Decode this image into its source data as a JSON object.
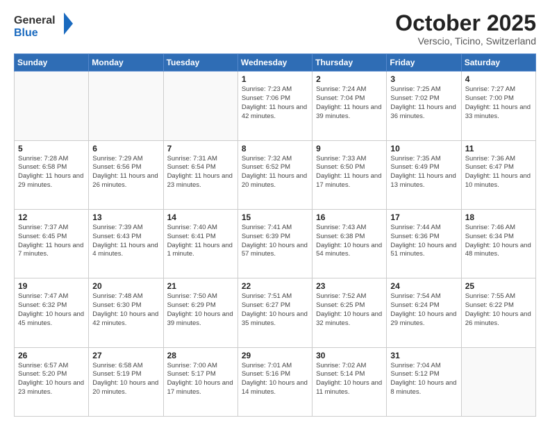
{
  "header": {
    "logo_general": "General",
    "logo_blue": "Blue",
    "month_title": "October 2025",
    "subtitle": "Verscio, Ticino, Switzerland"
  },
  "days_of_week": [
    "Sunday",
    "Monday",
    "Tuesday",
    "Wednesday",
    "Thursday",
    "Friday",
    "Saturday"
  ],
  "weeks": [
    [
      {
        "day": "",
        "info": ""
      },
      {
        "day": "",
        "info": ""
      },
      {
        "day": "",
        "info": ""
      },
      {
        "day": "1",
        "info": "Sunrise: 7:23 AM\nSunset: 7:06 PM\nDaylight: 11 hours and 42 minutes."
      },
      {
        "day": "2",
        "info": "Sunrise: 7:24 AM\nSunset: 7:04 PM\nDaylight: 11 hours and 39 minutes."
      },
      {
        "day": "3",
        "info": "Sunrise: 7:25 AM\nSunset: 7:02 PM\nDaylight: 11 hours and 36 minutes."
      },
      {
        "day": "4",
        "info": "Sunrise: 7:27 AM\nSunset: 7:00 PM\nDaylight: 11 hours and 33 minutes."
      }
    ],
    [
      {
        "day": "5",
        "info": "Sunrise: 7:28 AM\nSunset: 6:58 PM\nDaylight: 11 hours and 29 minutes."
      },
      {
        "day": "6",
        "info": "Sunrise: 7:29 AM\nSunset: 6:56 PM\nDaylight: 11 hours and 26 minutes."
      },
      {
        "day": "7",
        "info": "Sunrise: 7:31 AM\nSunset: 6:54 PM\nDaylight: 11 hours and 23 minutes."
      },
      {
        "day": "8",
        "info": "Sunrise: 7:32 AM\nSunset: 6:52 PM\nDaylight: 11 hours and 20 minutes."
      },
      {
        "day": "9",
        "info": "Sunrise: 7:33 AM\nSunset: 6:50 PM\nDaylight: 11 hours and 17 minutes."
      },
      {
        "day": "10",
        "info": "Sunrise: 7:35 AM\nSunset: 6:49 PM\nDaylight: 11 hours and 13 minutes."
      },
      {
        "day": "11",
        "info": "Sunrise: 7:36 AM\nSunset: 6:47 PM\nDaylight: 11 hours and 10 minutes."
      }
    ],
    [
      {
        "day": "12",
        "info": "Sunrise: 7:37 AM\nSunset: 6:45 PM\nDaylight: 11 hours and 7 minutes."
      },
      {
        "day": "13",
        "info": "Sunrise: 7:39 AM\nSunset: 6:43 PM\nDaylight: 11 hours and 4 minutes."
      },
      {
        "day": "14",
        "info": "Sunrise: 7:40 AM\nSunset: 6:41 PM\nDaylight: 11 hours and 1 minute."
      },
      {
        "day": "15",
        "info": "Sunrise: 7:41 AM\nSunset: 6:39 PM\nDaylight: 10 hours and 57 minutes."
      },
      {
        "day": "16",
        "info": "Sunrise: 7:43 AM\nSunset: 6:38 PM\nDaylight: 10 hours and 54 minutes."
      },
      {
        "day": "17",
        "info": "Sunrise: 7:44 AM\nSunset: 6:36 PM\nDaylight: 10 hours and 51 minutes."
      },
      {
        "day": "18",
        "info": "Sunrise: 7:46 AM\nSunset: 6:34 PM\nDaylight: 10 hours and 48 minutes."
      }
    ],
    [
      {
        "day": "19",
        "info": "Sunrise: 7:47 AM\nSunset: 6:32 PM\nDaylight: 10 hours and 45 minutes."
      },
      {
        "day": "20",
        "info": "Sunrise: 7:48 AM\nSunset: 6:30 PM\nDaylight: 10 hours and 42 minutes."
      },
      {
        "day": "21",
        "info": "Sunrise: 7:50 AM\nSunset: 6:29 PM\nDaylight: 10 hours and 39 minutes."
      },
      {
        "day": "22",
        "info": "Sunrise: 7:51 AM\nSunset: 6:27 PM\nDaylight: 10 hours and 35 minutes."
      },
      {
        "day": "23",
        "info": "Sunrise: 7:52 AM\nSunset: 6:25 PM\nDaylight: 10 hours and 32 minutes."
      },
      {
        "day": "24",
        "info": "Sunrise: 7:54 AM\nSunset: 6:24 PM\nDaylight: 10 hours and 29 minutes."
      },
      {
        "day": "25",
        "info": "Sunrise: 7:55 AM\nSunset: 6:22 PM\nDaylight: 10 hours and 26 minutes."
      }
    ],
    [
      {
        "day": "26",
        "info": "Sunrise: 6:57 AM\nSunset: 5:20 PM\nDaylight: 10 hours and 23 minutes."
      },
      {
        "day": "27",
        "info": "Sunrise: 6:58 AM\nSunset: 5:19 PM\nDaylight: 10 hours and 20 minutes."
      },
      {
        "day": "28",
        "info": "Sunrise: 7:00 AM\nSunset: 5:17 PM\nDaylight: 10 hours and 17 minutes."
      },
      {
        "day": "29",
        "info": "Sunrise: 7:01 AM\nSunset: 5:16 PM\nDaylight: 10 hours and 14 minutes."
      },
      {
        "day": "30",
        "info": "Sunrise: 7:02 AM\nSunset: 5:14 PM\nDaylight: 10 hours and 11 minutes."
      },
      {
        "day": "31",
        "info": "Sunrise: 7:04 AM\nSunset: 5:12 PM\nDaylight: 10 hours and 8 minutes."
      },
      {
        "day": "",
        "info": ""
      }
    ]
  ]
}
